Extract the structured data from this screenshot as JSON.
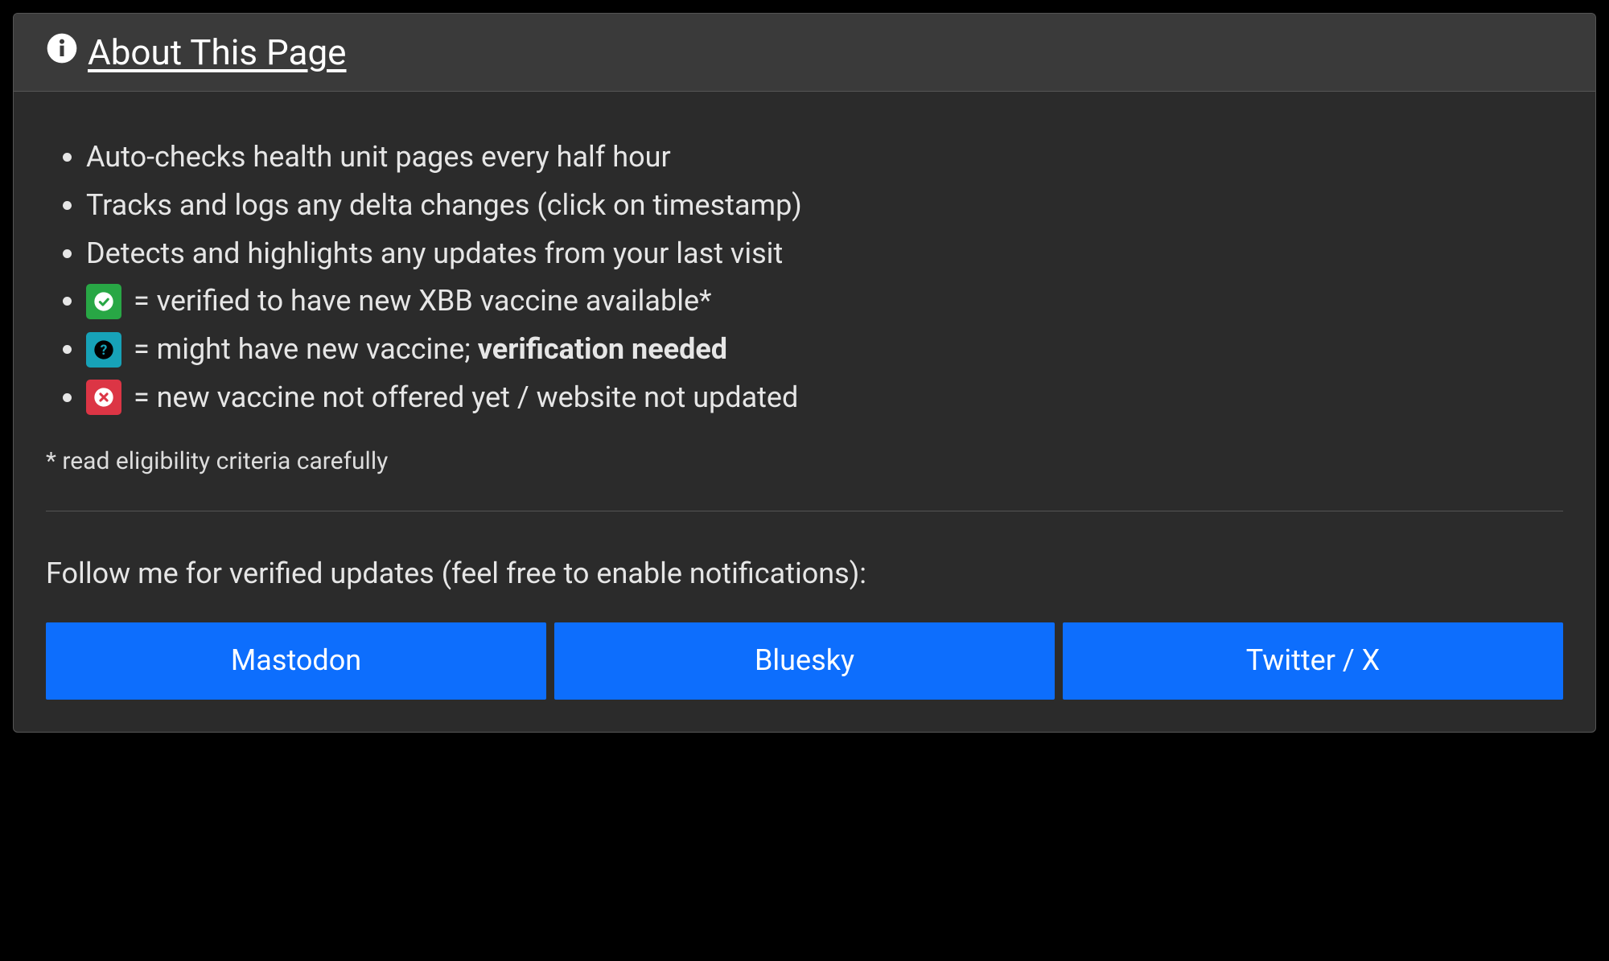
{
  "header": {
    "title": " About This Page"
  },
  "bullets": {
    "b1": "Auto-checks health unit pages every half hour",
    "b2": "Tracks and logs any delta changes (click on timestamp)",
    "b3": "Detects and highlights any updates from your last visit",
    "legend_verified": " = verified to have new XBB vaccine available*",
    "legend_maybe_prefix": " = might have new vaccine; ",
    "legend_maybe_strong": "verification needed",
    "legend_not": " = new vaccine not offered yet / website not updated"
  },
  "footnote": "* read eligibility criteria carefully",
  "follow_text": "Follow me for verified updates (feel free to enable notifications):",
  "buttons": {
    "mastodon": "Mastodon",
    "bluesky": "Bluesky",
    "twitter": "Twitter / X"
  }
}
